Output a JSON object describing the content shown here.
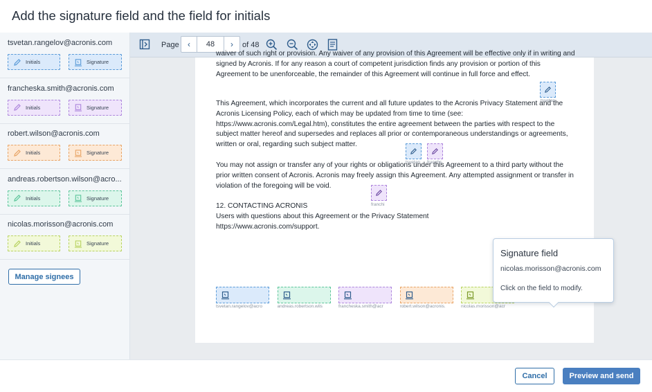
{
  "page_title": "Add the signature field and the field for initials",
  "field_labels": {
    "initials": "Initials",
    "signature": "Signature"
  },
  "signees": [
    {
      "email": "tsvetan.rangelov@acronis.com",
      "color": "#dbeafb",
      "border": "#5b9bd8"
    },
    {
      "email": "francheska.smith@acronis.com",
      "color": "#efe4fb",
      "border": "#ad86dc"
    },
    {
      "email": "robert.wilson@acronis.com",
      "color": "#fde9d6",
      "border": "#e8a465"
    },
    {
      "email": "andreas.robertson.wilson@acro...",
      "color": "#dcf6eb",
      "border": "#5cc49a"
    },
    {
      "email": "nicolas.morisson@acronis.com",
      "color": "#f2f9d9",
      "border": "#b8d260"
    }
  ],
  "sidebar": {
    "manage_button": "Manage signees"
  },
  "toolbar": {
    "page_label": "Page",
    "page_number": "48",
    "of_label": "of 48",
    "prev": "‹",
    "next": "›"
  },
  "document": {
    "paragraphs": [
      "waiver of such right or provision. Any waiver of any provision of this Agreement will be effective only if in writing and signed by Acronis. If for any reason a court of competent jurisdiction finds any provision or portion of this Agreement to be unenforceable, the remainder of this Agreement will continue in full force and effect.",
      "This Agreement, which incorporates the current and all future updates to the Acronis Privacy Statement and the Acronis Licensing Policy, each of which may be updated from time to time (see: https://www.acronis.com/Legal.htm), constitutes the entire agreement between the parties with respect to the subject matter hereof and supersedes and replaces all prior or contemporaneous understandings or agreements, written or oral, regarding such subject matter.",
      "You may not assign or transfer any of your rights or obligations under this Agreement to a third party without the prior written consent of Acronis. Acronis may freely assign this Agreement. Any attempted assignment or transfer in violation of the foregoing will be void.",
      "12. CONTACTING ACRONIS",
      " Users with questions about this Agreement or the Privacy Statement",
      "https://www.acronis.com/support."
    ],
    "initial_field_captions": [
      "tsvetan",
      "tsvetan",
      "franchs",
      "franchi"
    ],
    "signature_field_captions": [
      "tsvetan.rangelov@acro",
      "andreas.robertson.wils",
      "francheska.smith@acr",
      "robert.wilson@acronis.",
      "nicolas.morisson@acr"
    ]
  },
  "tooltip": {
    "title": "Signature field",
    "email": "nicolas.morisson@acronis.com",
    "hint": "Click on the field to modify."
  },
  "footer": {
    "cancel_label": "Cancel",
    "primary_label": "Preview and send"
  }
}
